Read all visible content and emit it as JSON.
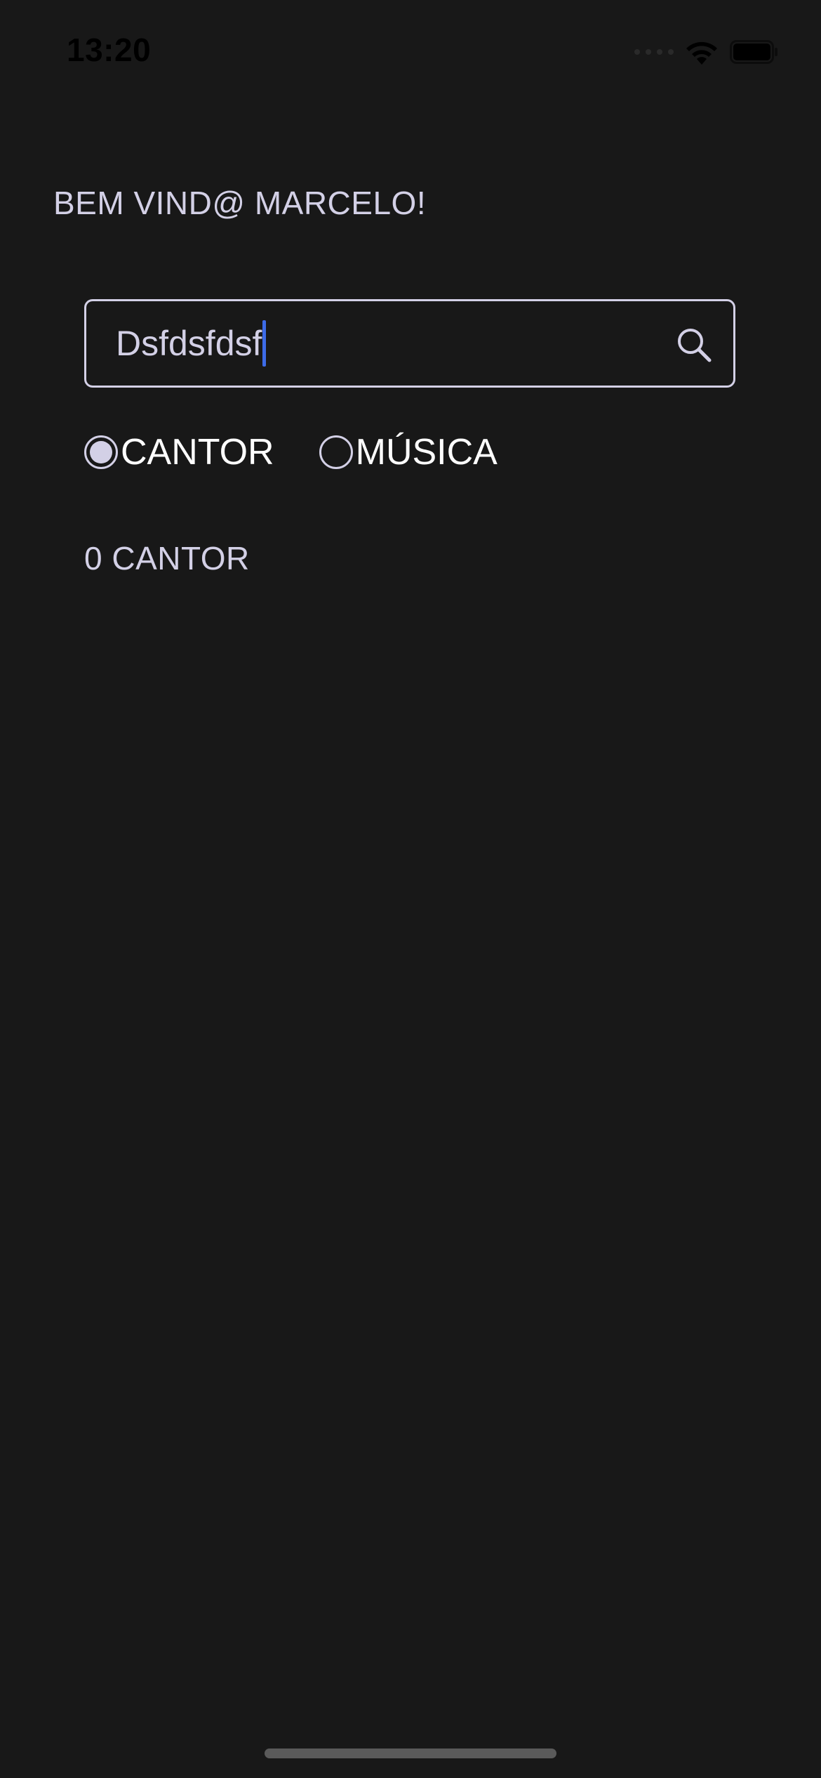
{
  "status_bar": {
    "time": "13:20",
    "icons": [
      "signal-icon",
      "wifi-icon",
      "battery-icon"
    ]
  },
  "greeting": "BEM VIND@ MARCELO!",
  "search": {
    "value": "Dsfdsfdsf",
    "icon": "search-icon"
  },
  "filter": {
    "options": [
      {
        "label": "CANTOR",
        "selected": true
      },
      {
        "label": "MÚSICA",
        "selected": false
      }
    ]
  },
  "results": {
    "count_text": "0 CANTOR"
  },
  "colors": {
    "background": "#181818",
    "text_primary": "#d3d0e6",
    "text_bright": "#ffffff",
    "caret": "#3d6be8"
  }
}
